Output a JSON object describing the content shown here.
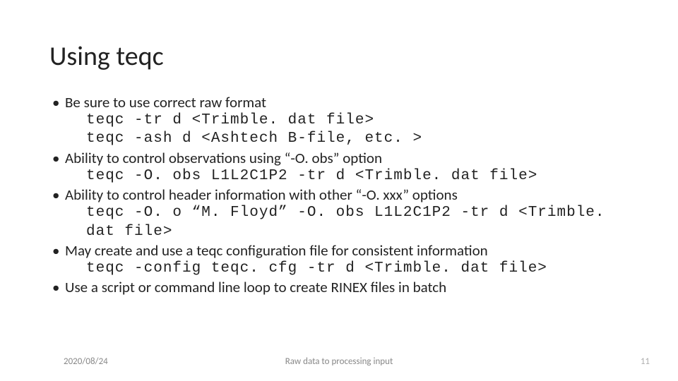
{
  "title": "Using teqc",
  "bullets": {
    "b1": {
      "text": "Be sure to use correct raw format",
      "code1": "teqc -tr d <Trimble. dat file>",
      "code2": "teqc -ash d <Ashtech B-file, etc. >"
    },
    "b2": {
      "text": "Ability to control observations using “-O. obs” option",
      "code1": "teqc -O. obs L1L2C1P2 -tr d <Trimble. dat file>"
    },
    "b3": {
      "text": "Ability to control header information with other “-O. xxx” options",
      "code1": "teqc -O. o “M. Floyd” -O. obs L1L2C1P2 -tr d <Trimble. dat file>"
    },
    "b4": {
      "text": "May create and use a teqc configuration file for consistent information",
      "code1": "teqc -config teqc. cfg -tr d <Trimble. dat file>"
    },
    "b5": {
      "text": "Use a script or command line loop to create RINEX files in batch"
    }
  },
  "footer": {
    "date": "2020/08/24",
    "center": "Raw data to processing input",
    "page": "11"
  }
}
